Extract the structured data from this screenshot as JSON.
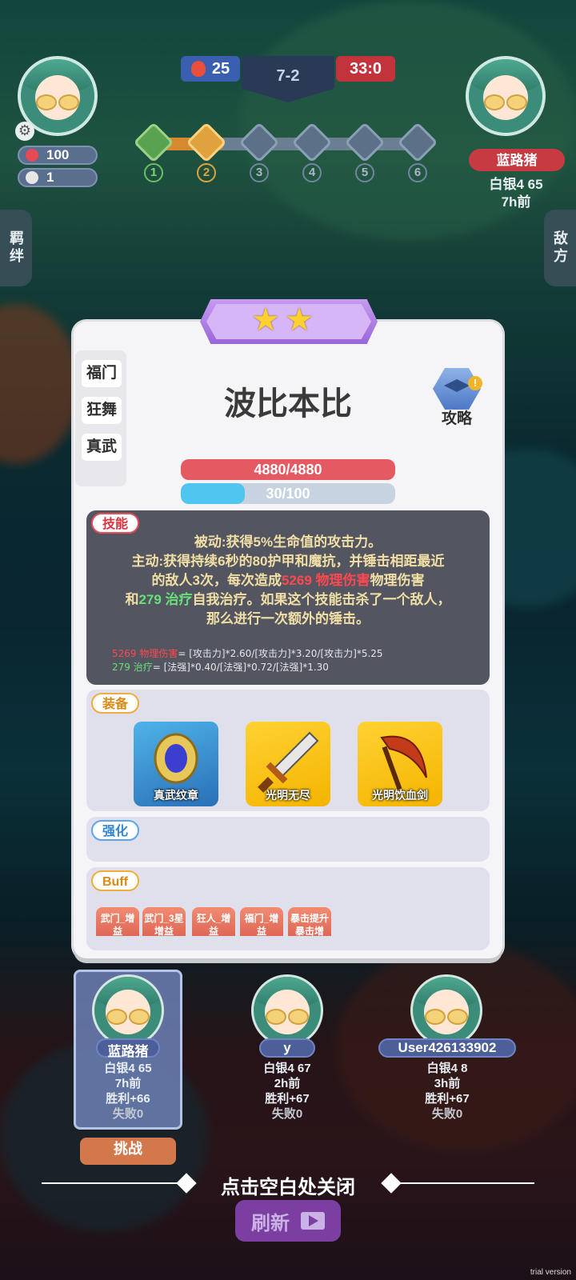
{
  "hud": {
    "player_hp": "100",
    "player_coins": "1",
    "score_left": "25",
    "round": "7-2",
    "score_right": "33:0",
    "stages": [
      "1",
      "2",
      "3",
      "4",
      "5",
      "6"
    ],
    "enemy_name": "蓝路猪",
    "enemy_rank": "白银4 65",
    "enemy_time": "7h前"
  },
  "side_tabs": {
    "left": "羁绊",
    "right": "敌方"
  },
  "unit": {
    "name": "波比本比",
    "star_count": 2,
    "traits": [
      "福门",
      "狂舞",
      "真武"
    ],
    "guide_label": "攻略",
    "hp_text": "4880/4880",
    "mana_text": "30/100",
    "mana_fraction": 0.3
  },
  "skill": {
    "tag": "技能",
    "line1": "被动:获得5%生命值的攻击力。",
    "line2": "主动:获得持续6秒的80护甲和魔抗，并锤击相距最近",
    "line3a": "的敌人3次，每次造成",
    "line3_dmg": "5269 物理伤害",
    "line3b": "物理伤害",
    "line4a": "和",
    "line4_heal": "279 治疗",
    "line4b": "自我治疗。如果这个技能击杀了一个敌人，",
    "line5": "那么进行一次额外的锤击。",
    "formula1_label": "5269 物理伤害",
    "formula1_rest": "= [攻击力]*2.60/[攻击力]*3.20/[攻击力]*5.25",
    "formula2_label": "279 治疗",
    "formula2_rest": "= [法强]*0.40/[法强]*0.72/[法强]*1.30"
  },
  "equipment": {
    "tag": "装备",
    "items": [
      "真武纹章",
      "光明无尽",
      "光明饮血剑"
    ]
  },
  "enhance": {
    "tag": "强化"
  },
  "buff": {
    "tag": "Buff",
    "chips": [
      [
        "武门_增",
        "益"
      ],
      [
        "武门_3星",
        "增益"
      ],
      [
        "狂人_增",
        "益"
      ],
      [
        "福门_增",
        "益"
      ],
      [
        "暴击提升",
        "暴击增"
      ]
    ]
  },
  "players": [
    {
      "name": "蓝路猪",
      "rank": "白银4 65",
      "time": "7h前",
      "wins": "胜利+66",
      "losses": "失败0"
    },
    {
      "name": "y",
      "rank": "白银4 67",
      "time": "2h前",
      "wins": "胜利+67",
      "losses": "失败0"
    },
    {
      "name": "User426133902",
      "rank": "白银4 8",
      "time": "3h前",
      "wins": "胜利+67",
      "losses": "失败0"
    }
  ],
  "actions": {
    "challenge": "挑战",
    "close_hint": "点击空白处关闭",
    "refresh": "刷新"
  },
  "watermark": "trial version",
  "colors": {
    "hp": "#e55a62",
    "mana": "#4fc6ef",
    "accent_purple": "#7a3fa1"
  }
}
